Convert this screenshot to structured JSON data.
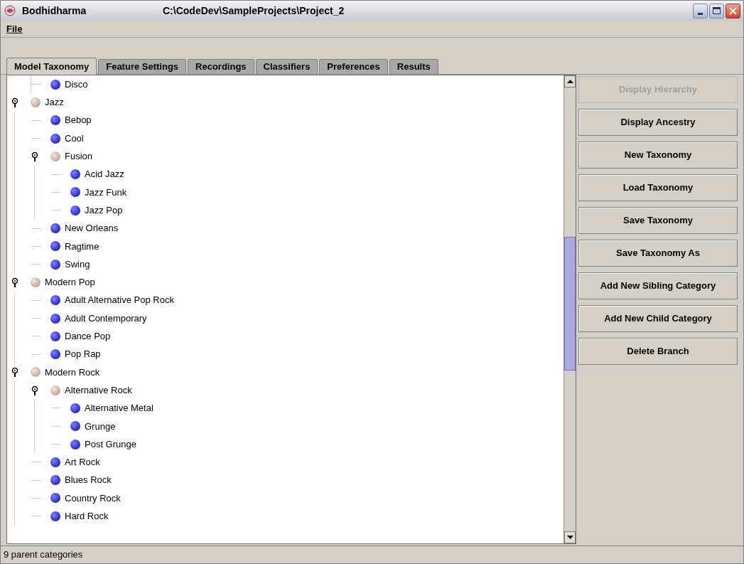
{
  "window": {
    "title": "Bodhidharma",
    "path": "C:\\CodeDev\\SampleProjects\\Project_2"
  },
  "menu": [
    "File"
  ],
  "tabs": [
    {
      "label": "Model Taxonomy",
      "selected": true
    },
    {
      "label": "Feature Settings",
      "selected": false
    },
    {
      "label": "Recordings",
      "selected": false
    },
    {
      "label": "Classifiers",
      "selected": false
    },
    {
      "label": "Preferences",
      "selected": false
    },
    {
      "label": "Results",
      "selected": false
    }
  ],
  "tree": [
    {
      "kind": "continued",
      "children": [
        {
          "label": "Disco"
        }
      ]
    },
    {
      "label": "Jazz",
      "expanded": true,
      "children": [
        {
          "label": "Bebop"
        },
        {
          "label": "Cool"
        },
        {
          "label": "Fusion",
          "expanded": true,
          "children": [
            {
              "label": "Acid Jazz"
            },
            {
              "label": "Jazz Funk"
            },
            {
              "label": "Jazz Pop"
            }
          ]
        },
        {
          "label": "New Orleans"
        },
        {
          "label": "Ragtime"
        },
        {
          "label": "Swing"
        }
      ]
    },
    {
      "label": "Modern Pop",
      "expanded": true,
      "children": [
        {
          "label": "Adult Alternative Pop Rock"
        },
        {
          "label": "Adult Contemporary"
        },
        {
          "label": "Dance Pop"
        },
        {
          "label": "Pop Rap"
        }
      ]
    },
    {
      "label": "Modern Rock",
      "expanded": true,
      "children": [
        {
          "label": "Alternative Rock",
          "expanded": true,
          "children": [
            {
              "label": "Alternative Metal"
            },
            {
              "label": "Grunge"
            },
            {
              "label": "Post Grunge"
            }
          ]
        },
        {
          "label": "Art Rock"
        },
        {
          "label": "Blues Rock"
        },
        {
          "label": "Country Rock"
        },
        {
          "label": "Hard Rock"
        }
      ]
    }
  ],
  "buttons": [
    {
      "label": "Display Hierarchy",
      "disabled": true
    },
    {
      "label": "Display Ancestry",
      "disabled": false
    },
    {
      "label": "New Taxonomy",
      "disabled": false
    },
    {
      "label": "Load Taxonomy",
      "disabled": false
    },
    {
      "label": "Save Taxonomy",
      "disabled": false
    },
    {
      "label": "Save Taxonomy As",
      "disabled": false
    },
    {
      "label": "Add New Sibling Category",
      "disabled": false
    },
    {
      "label": "Add New Child Category",
      "disabled": false
    },
    {
      "label": "Delete Branch",
      "disabled": false
    }
  ],
  "status_bar": "9 parent categories"
}
